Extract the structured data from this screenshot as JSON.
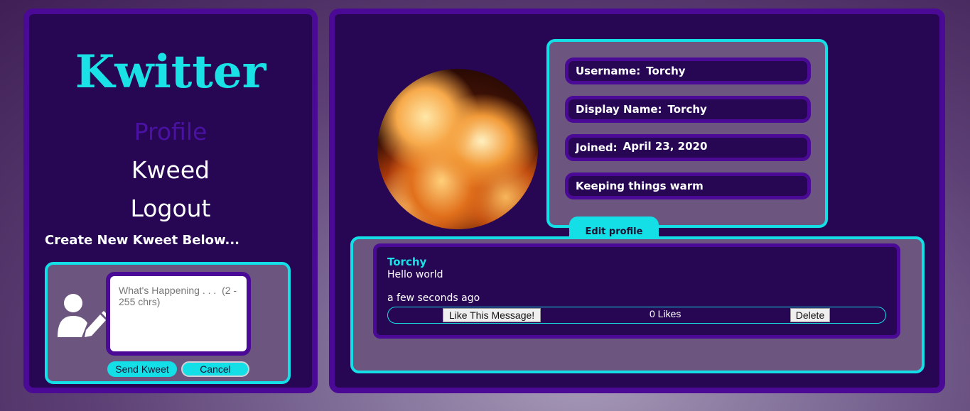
{
  "app": {
    "brand": "Kwitter"
  },
  "nav": [
    {
      "label": "Profile",
      "active": true
    },
    {
      "label": "Kweed",
      "active": false
    },
    {
      "label": "Logout",
      "active": false
    }
  ],
  "compose": {
    "heading": "Create New Kweet Below...",
    "placeholder": "What's Happening . . .  (2 - 255 chrs)",
    "value": "",
    "send_label": "Send Kweet",
    "cancel_label": "Cancel",
    "icon": "user-edit-icon"
  },
  "profile": {
    "avatar": "fire-avatar",
    "username_label": "Username:",
    "username": "Torchy",
    "display_name_label": "Display Name:",
    "display_name": "Torchy",
    "joined_label": "Joined:",
    "joined": "April 23, 2020",
    "bio": "Keeping things warm",
    "edit_label": "Edit profile"
  },
  "feed": [
    {
      "author": "Torchy",
      "text": "Hello world",
      "time": "a few seconds ago",
      "like_label": "Like This Message!",
      "likes": "0 Likes",
      "delete_label": "Delete"
    }
  ],
  "colors": {
    "accent": "#14dfe6",
    "panel": "#270654",
    "border": "#4a0a96",
    "card": "#6c5680"
  }
}
